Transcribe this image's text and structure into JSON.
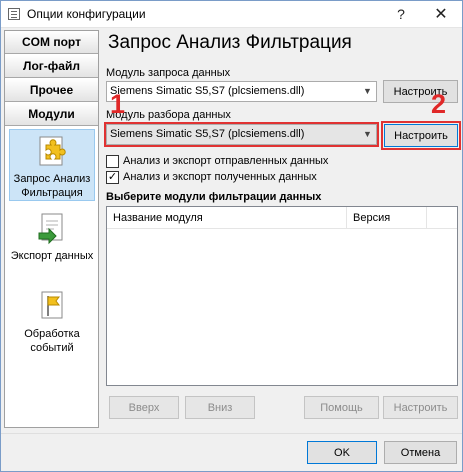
{
  "window": {
    "title": "Опции конфигурации",
    "help_label": "?",
    "close_label": "✕"
  },
  "nav": {
    "tabs": [
      "COM порт",
      "Лог-файл",
      "Прочее",
      "Модули"
    ],
    "items": [
      {
        "label": "Запрос Анализ Фильтрация",
        "icon": "puzzle-icon",
        "active": true
      },
      {
        "label": "Экспорт данных",
        "icon": "export-document-icon",
        "active": false
      },
      {
        "label": "Обработка событий",
        "icon": "flag-document-icon",
        "active": false
      }
    ]
  },
  "page": {
    "title": "Запрос Анализ Фильтрация",
    "query_module_label": "Модуль запроса данных",
    "query_module_value": "Siemens Simatic S5,S7 (plcsiemens.dll)",
    "parse_module_label": "Модуль разбора данных",
    "parse_module_value": "Siemens Simatic S5,S7 (plcsiemens.dll)",
    "configure_label": "Настроить",
    "check_sent_label": "Анализ и экспорт отправленных данных",
    "check_sent_checked": false,
    "check_received_label": "Анализ и экспорт полученных данных",
    "check_received_checked": true,
    "filter_section_label": "Выберите модули фильтрации данных",
    "columns": [
      "Название модуля",
      "Версия"
    ],
    "rows": [],
    "up_label": "Вверх",
    "down_label": "Вниз",
    "help_label": "Помощь",
    "filter_configure_label": "Настроить"
  },
  "annotations": {
    "marker_1": "1",
    "marker_2": "2",
    "color": "#e02828"
  },
  "footer": {
    "ok_label": "OK",
    "cancel_label": "Отмена"
  },
  "colors": {
    "active_nav_bg": "#cce4f7",
    "button_bg": "#e1e1e1",
    "focus_border": "#0078d7"
  }
}
